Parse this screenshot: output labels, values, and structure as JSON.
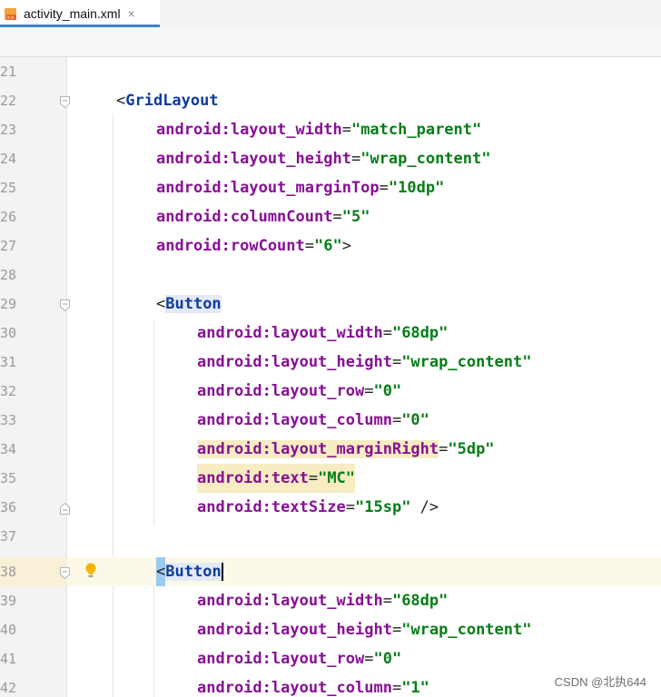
{
  "tab": {
    "label": "activity_main.xml",
    "close_glyph": "×",
    "icon": "xml-file-icon"
  },
  "lines": [
    {
      "num": "21"
    },
    {
      "num": "22"
    },
    {
      "num": "23",
      "attr": "android:layout_width",
      "value": "\"match_parent\""
    },
    {
      "num": "24",
      "attr": "android:layout_height",
      "value": "\"wrap_content\""
    },
    {
      "num": "25",
      "attr": "android:layout_marginTop",
      "value": "\"10dp\""
    },
    {
      "num": "26",
      "attr": "android:columnCount",
      "value": "\"5\""
    },
    {
      "num": "27",
      "attr": "android:rowCount",
      "value": "\"6\"",
      "suffix": ">"
    },
    {
      "num": "28"
    },
    {
      "num": "29"
    },
    {
      "num": "30",
      "attr": "android:layout_width",
      "value": "\"68dp\""
    },
    {
      "num": "31",
      "attr": "android:layout_height",
      "value": "\"wrap_content\""
    },
    {
      "num": "32",
      "attr": "android:layout_row",
      "value": "\"0\""
    },
    {
      "num": "33",
      "attr": "android:layout_column",
      "value": "\"0\""
    },
    {
      "num": "34",
      "attr": "android:layout_marginRight",
      "value": "\"5dp\""
    },
    {
      "num": "35",
      "attr": "android:text",
      "value": "\"MC\""
    },
    {
      "num": "36",
      "attr": "android:textSize",
      "value": "\"15sp\"",
      "suffix": " />"
    },
    {
      "num": "37"
    },
    {
      "num": "38"
    },
    {
      "num": "39",
      "attr": "android:layout_width",
      "value": "\"68dp\""
    },
    {
      "num": "40",
      "attr": "android:layout_height",
      "value": "\"wrap_content\""
    },
    {
      "num": "41",
      "attr": "android:layout_row",
      "value": "\"0\""
    },
    {
      "num": "42",
      "attr": "android:layout_column",
      "value": "\"1\""
    }
  ],
  "tags": {
    "open_bracket": "<",
    "grid": "GridLayout",
    "button1": "Button",
    "button2": "Butto",
    "button2_last": "n"
  },
  "equals": "=",
  "watermark": "CSDN @北执644",
  "colors": {
    "tag": "#0f3c9b",
    "attribute": "#871094",
    "string": "#067d17",
    "current_line": "#fcf9e9",
    "tab_accent": "#4083c9"
  }
}
